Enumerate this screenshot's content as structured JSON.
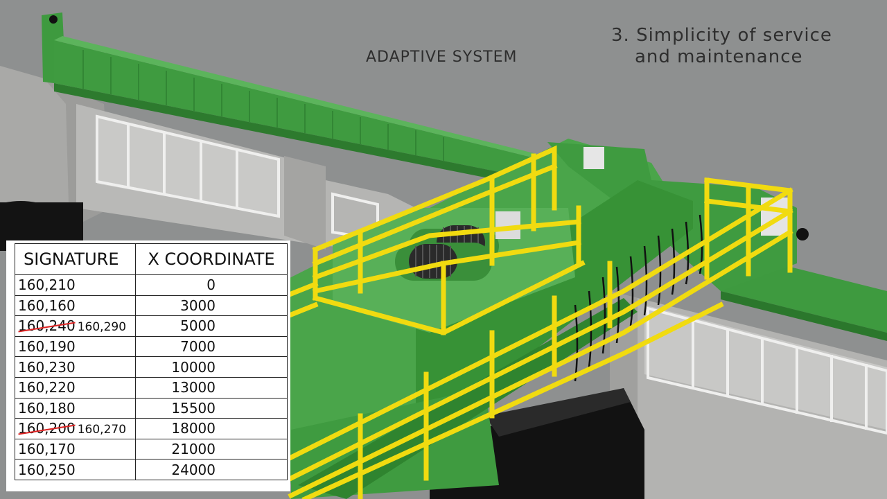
{
  "overlay": {
    "subtitle": "ADAPTIVE SYSTEM",
    "step_line1": "3. Simplicity of service",
    "step_line2": "and maintenance"
  },
  "table": {
    "headers": [
      "SIGNATURE",
      "X COORDINATE"
    ],
    "rows": [
      {
        "signature": "160,210",
        "x": "0"
      },
      {
        "signature": "160,160",
        "x": "3000"
      },
      {
        "signature": "160,240",
        "correction": "160,290",
        "x": "5000"
      },
      {
        "signature": "160,190",
        "x": "7000"
      },
      {
        "signature": "160,230",
        "x": "10000"
      },
      {
        "signature": "160,220",
        "x": "13000"
      },
      {
        "signature": "160,180",
        "x": "15500"
      },
      {
        "signature": "160,200",
        "correction": "160,270",
        "x": "18000"
      },
      {
        "signature": "160,170",
        "x": "21000"
      },
      {
        "signature": "160,250",
        "x": "24000"
      }
    ]
  },
  "colors": {
    "background": "#8d8f8f",
    "crane_green": "#3f9a3f",
    "rail_yellow": "#f2dc12",
    "wall_gray": "#b8b8b6",
    "pipe_black": "#111111",
    "strike_red": "#d22222"
  }
}
